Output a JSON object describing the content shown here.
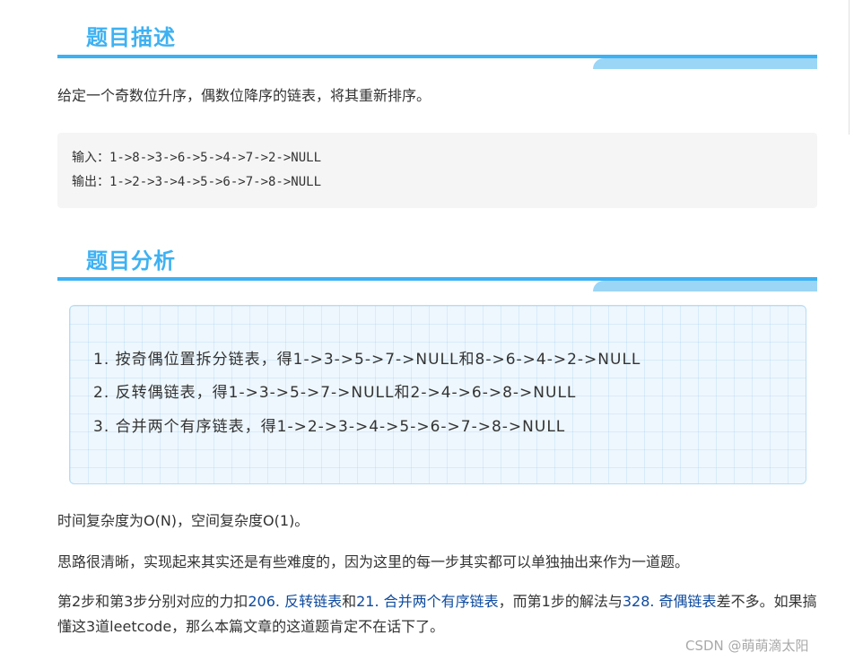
{
  "section1": {
    "title": "题目描述"
  },
  "description": "给定一个奇数位升序，偶数位降序的链表，将其重新排序。",
  "example": {
    "input_line": "输入：1->8->3->6->5->4->7->2->NULL",
    "output_line": "输出：1->2->3->4->5->6->7->8->NULL"
  },
  "section2": {
    "title": "题目分析"
  },
  "steps": [
    "1. 按奇偶位置拆分链表，得1->3->5->7->NULL和8->6->4->2->NULL",
    "2. 反转偶链表，得1->3->5->7->NULL和2->4->6->8->NULL",
    "3. 合并两个有序链表，得1->2->3->4->5->6->7->8->NULL"
  ],
  "complexity": "时间复杂度为O(N)，空间复杂度O(1)。",
  "thought": "思路很清晰，实现起来其实还是有些难度的，因为这里的每一步其实都可以单独抽出来作为一道题。",
  "related": {
    "part1": "第2步和第3步分别对应的力扣",
    "link1": "206. 反转链表",
    "part2": "和",
    "link2": "21. 合并两个有序链表",
    "part3": "，而第1步的解法与",
    "link3": "328. 奇偶链表",
    "part4": "差不多。如果搞懂这3道leetcode，那么本篇文章的这道题肯定不在话下了。"
  },
  "watermark": "CSDN @萌萌滴太阳",
  "colors": {
    "accent": "#3eb1f2",
    "accent_light": "#9bd6f7",
    "link": "#0d4a9e"
  }
}
